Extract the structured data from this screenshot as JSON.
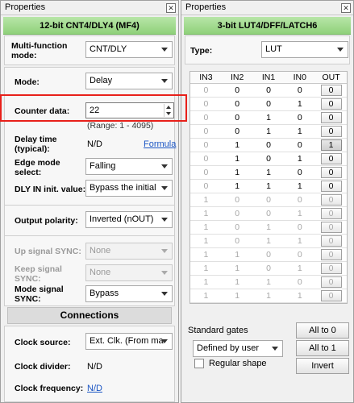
{
  "left": {
    "title": "Properties",
    "header": "12-bit CNT4/DLY4 (MF4)",
    "mf_mode": {
      "label": "Multi-function mode:",
      "value": "CNT/DLY"
    },
    "mode": {
      "label": "Mode:",
      "value": "Delay"
    },
    "counter": {
      "label": "Counter data:",
      "value": "22",
      "range": "(Range:  1 - 4095)"
    },
    "delay_time": {
      "label": "Delay time (typical):",
      "value": "N/D",
      "link": "Formula"
    },
    "edge_mode": {
      "label": "Edge mode select:",
      "value": "Falling"
    },
    "dly_in": {
      "label": "DLY IN init. value:",
      "value": "Bypass the initial"
    },
    "output_polarity": {
      "label": "Output polarity:",
      "value": "Inverted (nOUT)"
    },
    "up_signal": {
      "label": "Up signal SYNC:",
      "value": "None"
    },
    "keep_signal": {
      "label": "Keep signal SYNC:",
      "value": "None"
    },
    "mode_signal": {
      "label": "Mode signal SYNC:",
      "value": "Bypass"
    },
    "connections": "Connections",
    "clock_source": {
      "label": "Clock source:",
      "value": "Ext. Clk. (From ma"
    },
    "clock_divider": {
      "label": "Clock divider:",
      "value": "N/D"
    },
    "clock_frequency": {
      "label": "Clock frequency:",
      "value": "N/D"
    }
  },
  "right": {
    "title": "Properties",
    "header": "3-bit LUT4/DFF/LATCH6",
    "type": {
      "label": "Type:",
      "value": "LUT"
    },
    "table": {
      "headers": [
        "IN3",
        "IN2",
        "IN1",
        "IN0",
        "OUT"
      ],
      "rows": [
        [
          "0",
          "0",
          "0",
          "0",
          "0"
        ],
        [
          "0",
          "0",
          "0",
          "1",
          "0"
        ],
        [
          "0",
          "0",
          "1",
          "0",
          "0"
        ],
        [
          "0",
          "0",
          "1",
          "1",
          "0"
        ],
        [
          "0",
          "1",
          "0",
          "0",
          "1"
        ],
        [
          "0",
          "1",
          "0",
          "1",
          "0"
        ],
        [
          "0",
          "1",
          "1",
          "0",
          "0"
        ],
        [
          "0",
          "1",
          "1",
          "1",
          "0"
        ],
        [
          "1",
          "0",
          "0",
          "0",
          "0"
        ],
        [
          "1",
          "0",
          "0",
          "1",
          "0"
        ],
        [
          "1",
          "0",
          "1",
          "0",
          "0"
        ],
        [
          "1",
          "0",
          "1",
          "1",
          "0"
        ],
        [
          "1",
          "1",
          "0",
          "0",
          "0"
        ],
        [
          "1",
          "1",
          "0",
          "1",
          "0"
        ],
        [
          "1",
          "1",
          "1",
          "0",
          "0"
        ],
        [
          "1",
          "1",
          "1",
          "1",
          "0"
        ]
      ]
    },
    "standard_gates": "Standard gates",
    "gates_select": "Defined by user",
    "regular_shape": "Regular shape",
    "all_to_0": "All to 0",
    "all_to_1": "All to 1",
    "invert": "Invert"
  },
  "close_glyph": "✕",
  "colors": {
    "accent_green": "#8fd17a",
    "highlight_red": "#e8201a",
    "link_blue": "#1a55c4"
  }
}
